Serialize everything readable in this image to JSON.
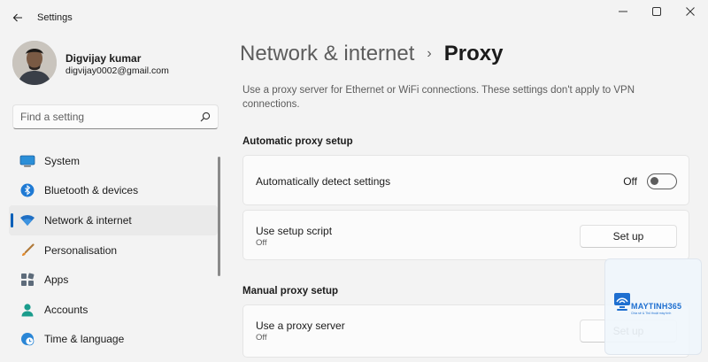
{
  "window": {
    "title": "Settings"
  },
  "profile": {
    "name": "Digvijay kumar",
    "email": "digvijay0002@gmail.com"
  },
  "search": {
    "placeholder": "Find a setting"
  },
  "sidebar": {
    "items": [
      {
        "label": "System",
        "icon": "monitor-icon",
        "active": false
      },
      {
        "label": "Bluetooth & devices",
        "icon": "bluetooth-icon",
        "active": false
      },
      {
        "label": "Network & internet",
        "icon": "wifi-icon",
        "active": true
      },
      {
        "label": "Personalisation",
        "icon": "paintbrush-icon",
        "active": false
      },
      {
        "label": "Apps",
        "icon": "apps-icon",
        "active": false
      },
      {
        "label": "Accounts",
        "icon": "person-icon",
        "active": false
      },
      {
        "label": "Time & language",
        "icon": "globe-clock-icon",
        "active": false
      }
    ]
  },
  "breadcrumb": {
    "parent": "Network & internet",
    "separator": "›",
    "current": "Proxy"
  },
  "description": "Use a proxy server for Ethernet or WiFi connections. These settings don't apply to VPN connections.",
  "automatic": {
    "title": "Automatic proxy setup",
    "detect": {
      "label": "Automatically detect settings",
      "state": "Off"
    },
    "script": {
      "label": "Use setup script",
      "status": "Off",
      "button": "Set up"
    }
  },
  "manual": {
    "title": "Manual proxy setup",
    "proxy": {
      "label": "Use a proxy server",
      "status": "Off",
      "button": "Set up"
    }
  },
  "watermark": {
    "brand": "MAYTINH365",
    "tagline": "Chia sẻ & Thủ thuật máy tính"
  },
  "colors": {
    "accent": "#005fb8",
    "background": "#f3f3f3",
    "card": "#fbfbfb"
  }
}
